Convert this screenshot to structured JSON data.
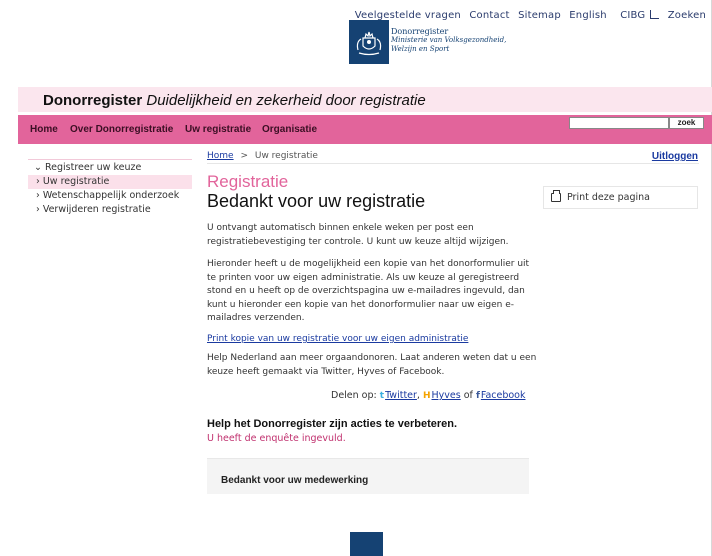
{
  "utility_nav": [
    "Veelgestelde vragen",
    "Contact",
    "Sitemap",
    "English",
    "CIBG",
    "Zoeken"
  ],
  "logo": {
    "line1": "Donorregister",
    "line2": "Ministerie van Volksgezondheid,",
    "line3": "Welzijn en Sport"
  },
  "brand": {
    "name": "Donorregister",
    "tagline": "Duidelijkheid en zekerheid door registratie"
  },
  "main_nav": [
    "Home",
    "Over Donorregistratie",
    "Uw registratie",
    "Organisatie"
  ],
  "search": {
    "value": "",
    "button": "zoek"
  },
  "side_nav": {
    "parent": "Registreer uw keuze",
    "items": [
      "Uw registratie",
      "Wetenschappelijk onderzoek",
      "Verwijderen registratie"
    ]
  },
  "breadcrumb": {
    "home": "Home",
    "sep": ">",
    "current": "Uw registratie"
  },
  "logout": "Uitloggen",
  "section_label": "Registratie",
  "page_title": "Bedankt voor uw registratie",
  "paragraphs": {
    "p1": "U ontvangt automatisch binnen enkele weken per post een registratiebevestiging ter controle. U kunt uw keuze altijd wijzigen.",
    "p2": "Hieronder heeft u de mogelijkheid een kopie van het donorformulier uit te printen voor uw eigen administratie. Als uw keuze al geregistreerd stond en u heeft op de overzichtspagina uw e-mailadres ingevuld, dan kunt u hieronder een kopie van het donorformulier naar uw eigen e-mailadres verzenden.",
    "print_link": "Print kopie van uw registratie voor uw eigen administratie",
    "p3": "Help Nederland aan meer orgaandonoren. Laat anderen weten dat u een keuze heeft gemaakt via Twitter, Hyves of Facebook."
  },
  "share": {
    "label": "Delen op:",
    "twitter": "Twitter",
    "hyves": "Hyves",
    "of": "of",
    "facebook": "Facebook"
  },
  "print_page": "Print deze pagina",
  "help": {
    "title": "Help het Donorregister zijn acties te verbeteren.",
    "subtitle": "U heeft de enquête ingevuld."
  },
  "thanks": "Bedankt voor uw medewerking",
  "colors": {
    "accent_pink": "#e2649b",
    "band_pink": "#fbe6ee",
    "logo_blue": "#154273",
    "link_blue": "#1a3aa0"
  }
}
